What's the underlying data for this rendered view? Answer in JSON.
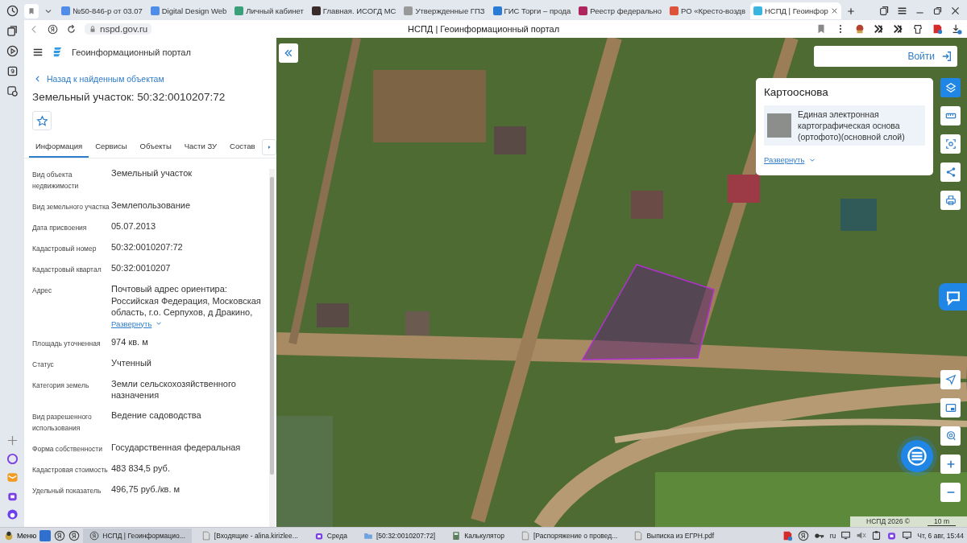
{
  "browser": {
    "tabs": [
      {
        "title": "№50-846-р от 03.07",
        "selected": false
      },
      {
        "title": "Digital Design Web",
        "selected": false
      },
      {
        "title": "Личный кабинет",
        "selected": false
      },
      {
        "title": "Главная. ИСОГД МС",
        "selected": false
      },
      {
        "title": "Утвержденные ГПЗ",
        "selected": false
      },
      {
        "title": "ГИС Торги – прода",
        "selected": false
      },
      {
        "title": "Реестр федерально",
        "selected": false
      },
      {
        "title": "РО «Кресто-воздв",
        "selected": false
      },
      {
        "title": "НСПД | Геоинфор",
        "selected": true
      }
    ],
    "address": "nspd.gov.ru",
    "page_title": "НСПД | Геоинформационный портал"
  },
  "portal": {
    "title": "Геоинформационный портал",
    "back_link": "Назад к найденным объектам",
    "heading": "Земельный участок: 50:32:0010207:72",
    "tabs": [
      {
        "label": "Информация",
        "selected": true
      },
      {
        "label": "Сервисы",
        "selected": false
      },
      {
        "label": "Объекты",
        "selected": false
      },
      {
        "label": "Части ЗУ",
        "selected": false
      },
      {
        "label": "Состав",
        "selected": false
      }
    ],
    "fields": [
      {
        "label": "Вид объекта недвижимости",
        "value": "Земельный участок"
      },
      {
        "label": "Вид земельного участка",
        "value": "Землепользование"
      },
      {
        "label": "Дата присвоения",
        "value": "05.07.2013"
      },
      {
        "label": "Кадастровый номер",
        "value": "50:32:0010207:72"
      },
      {
        "label": "Кадастровый квартал",
        "value": "50:32:0010207"
      },
      {
        "label": "Адрес",
        "value": "Почтовый адрес ориентира: Российская Федерация, Московская область, г.о. Серпухов, д Дракино,",
        "expand": "Развернуть"
      },
      {
        "label": "Площадь уточненная",
        "value": "974 кв. м"
      },
      {
        "label": "Статус",
        "value": "Учтенный"
      },
      {
        "label": "Категория земель",
        "value": "Земли сельскохозяйственного назначения"
      },
      {
        "label": "Вид разрешенного использования",
        "value": "Ведение садоводства"
      },
      {
        "label": "Форма собственности",
        "value": "Государственная федеральная"
      },
      {
        "label": "Кадастровая стоимость",
        "value": "483 834,5 руб."
      },
      {
        "label": "Удельный показатель",
        "value": "496,75 руб./кв. м"
      }
    ]
  },
  "map": {
    "login": "Войти",
    "basemap": {
      "title": "Картооснова",
      "layer": "Единая электронная картографическая основа (ортофото)(основной слой)",
      "expand": "Развернуть"
    },
    "attribution": "НСПД 2026 ©",
    "scale": "10 m"
  },
  "taskbar": {
    "menu": "Меню",
    "windows": [
      {
        "title": "НСПД | Геоинформацио...",
        "selected": true
      },
      {
        "title": "[Входящие - alina.kirizlee...",
        "selected": false
      },
      {
        "title": "Среда",
        "selected": false
      },
      {
        "title": "[50:32:0010207:72]",
        "selected": false
      },
      {
        "title": "Калькулятор",
        "selected": false
      },
      {
        "title": "[Распоряжение о провед...",
        "selected": false
      },
      {
        "title": "Выписка из ЕГРН.pdf",
        "selected": false
      }
    ],
    "lang": "ru",
    "clock": "Чт, 6 авг, 15:44"
  }
}
